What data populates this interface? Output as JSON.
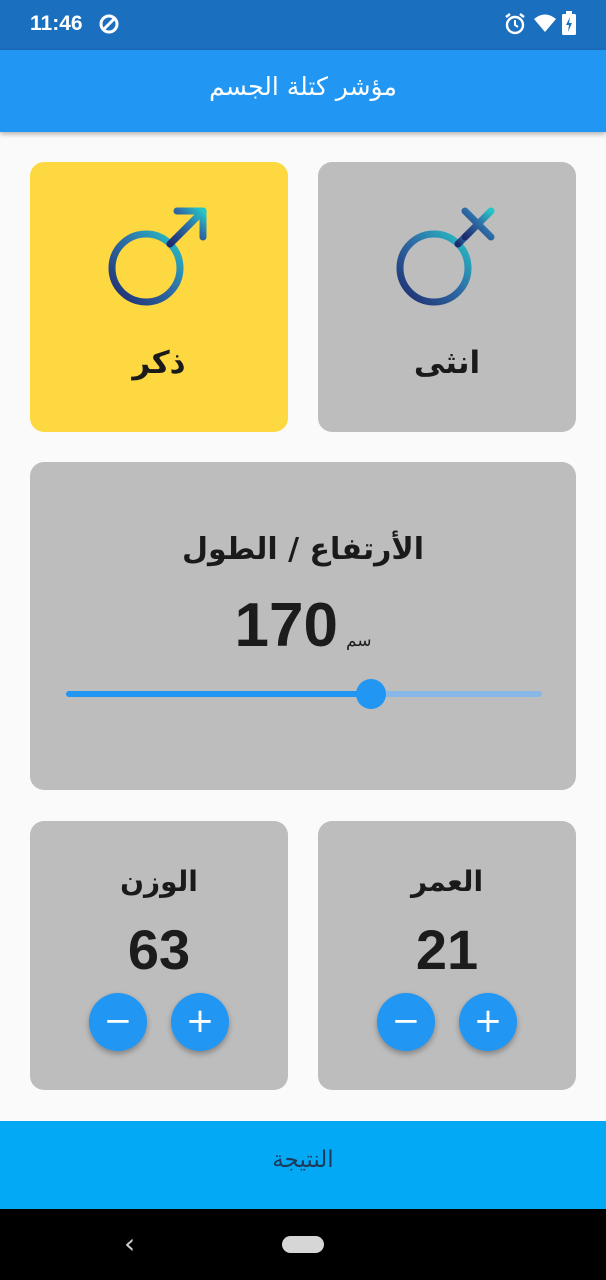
{
  "status_bar": {
    "time": "11:46",
    "icons": [
      "data-saver-icon",
      "alarm-icon",
      "wifi-icon",
      "battery-icon"
    ]
  },
  "app_bar": {
    "title": "مؤشر كتلة الجسم"
  },
  "gender": {
    "male": {
      "label": "ذكر",
      "selected": true,
      "icon": "male-symbol-icon"
    },
    "female": {
      "label": "انثى",
      "selected": false,
      "icon": "female-symbol-icon"
    }
  },
  "height": {
    "title": "الأرتفاع / الطول",
    "value": "170",
    "unit": "سم",
    "slider_fraction": 0.64
  },
  "weight": {
    "label": "الوزن",
    "value": "63",
    "minus": "−",
    "plus": "+"
  },
  "age": {
    "label": "العمر",
    "value": "21",
    "minus": "−",
    "plus": "+"
  },
  "result": {
    "label": "النتيجة"
  },
  "nav": {
    "back": "‹"
  },
  "colors": {
    "primary": "#2196f3",
    "selected_card": "#fdd840",
    "card": "#bdbdbd",
    "result_bar": "#03a9f4"
  }
}
